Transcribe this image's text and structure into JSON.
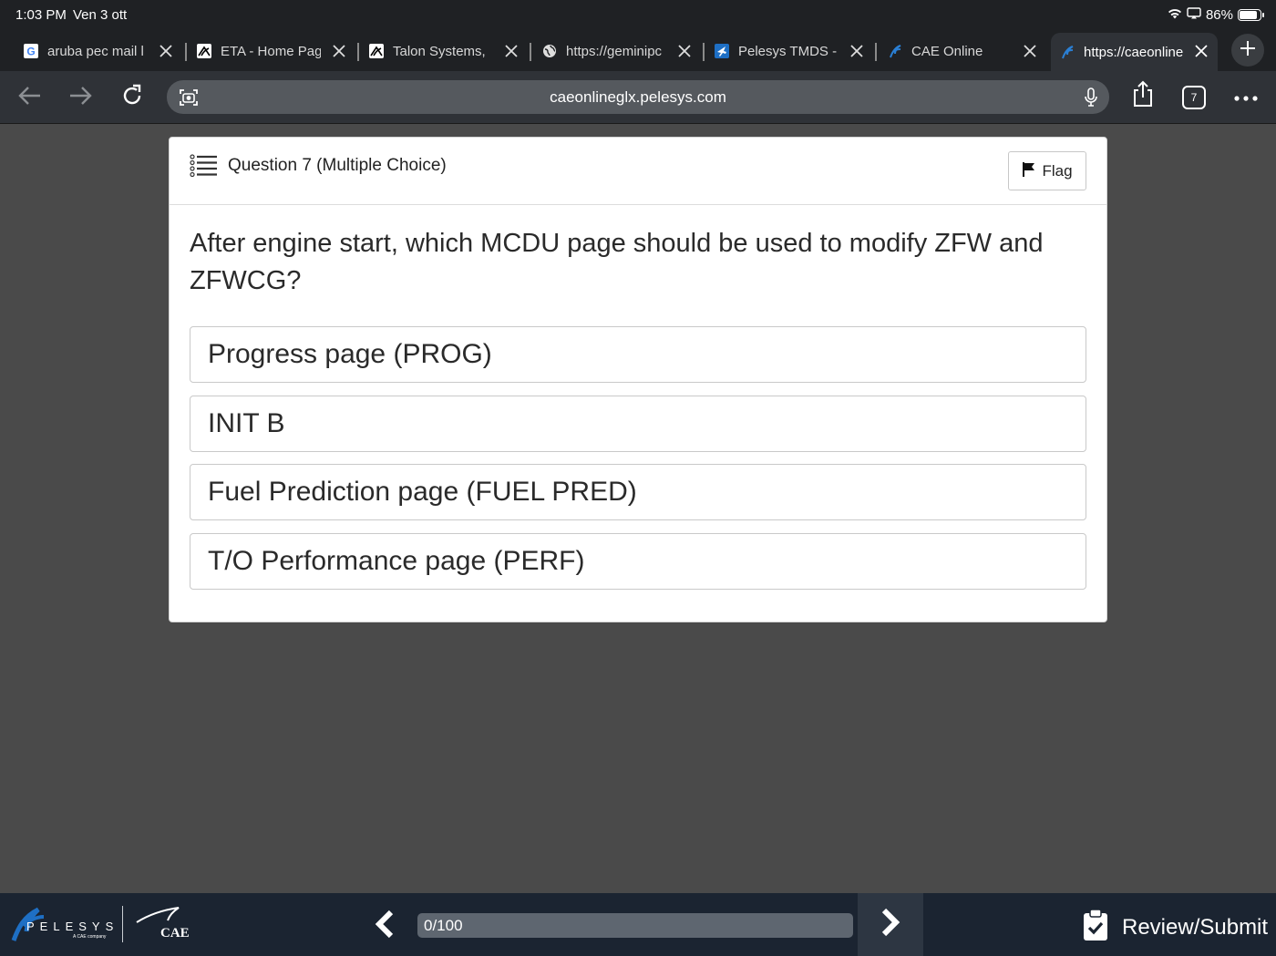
{
  "status_bar": {
    "time": "1:03 PM",
    "date": "Ven 3 ott",
    "battery": "86%",
    "battery_level": 0.86
  },
  "tabs": [
    {
      "title": "aruba pec mail l",
      "icon": "google-icon"
    },
    {
      "title": "ETA - Home Pag",
      "icon": "eta-icon"
    },
    {
      "title": "Talon Systems,",
      "icon": "talon-icon"
    },
    {
      "title": "https://geminipc",
      "icon": "globe-icon"
    },
    {
      "title": "Pelesys TMDS -",
      "icon": "airplane-icon"
    },
    {
      "title": "CAE Online",
      "icon": "pelesys-icon"
    },
    {
      "title": "https://caeonline",
      "icon": "pelesys-icon",
      "active": true
    }
  ],
  "toolbar": {
    "url": "caeonlineglx.pelesys.com",
    "tab_count": "7"
  },
  "question": {
    "header": "Question 7 (Multiple Choice)",
    "flag_label": "Flag",
    "text": "After engine start, which MCDU page should be used to modify ZFW and ZFWCG?",
    "options": [
      "Progress page (PROG)",
      "INIT B",
      "Fuel Prediction page (FUEL PRED)",
      "T/O Performance page (PERF)"
    ]
  },
  "footer": {
    "pelesys_logo_text": "PELESYS",
    "pelesys_tagline": "A CAE company",
    "cae_logo_text": "CAE",
    "progress_text": "0/100",
    "progress_fraction": 0.0,
    "review_label": "Review/Submit"
  },
  "colors": {
    "page_bg": "#4a4a4a",
    "browser_chrome": "#1f2124",
    "footer_bg": "#1b2431",
    "accent": "#1e6fc4"
  }
}
